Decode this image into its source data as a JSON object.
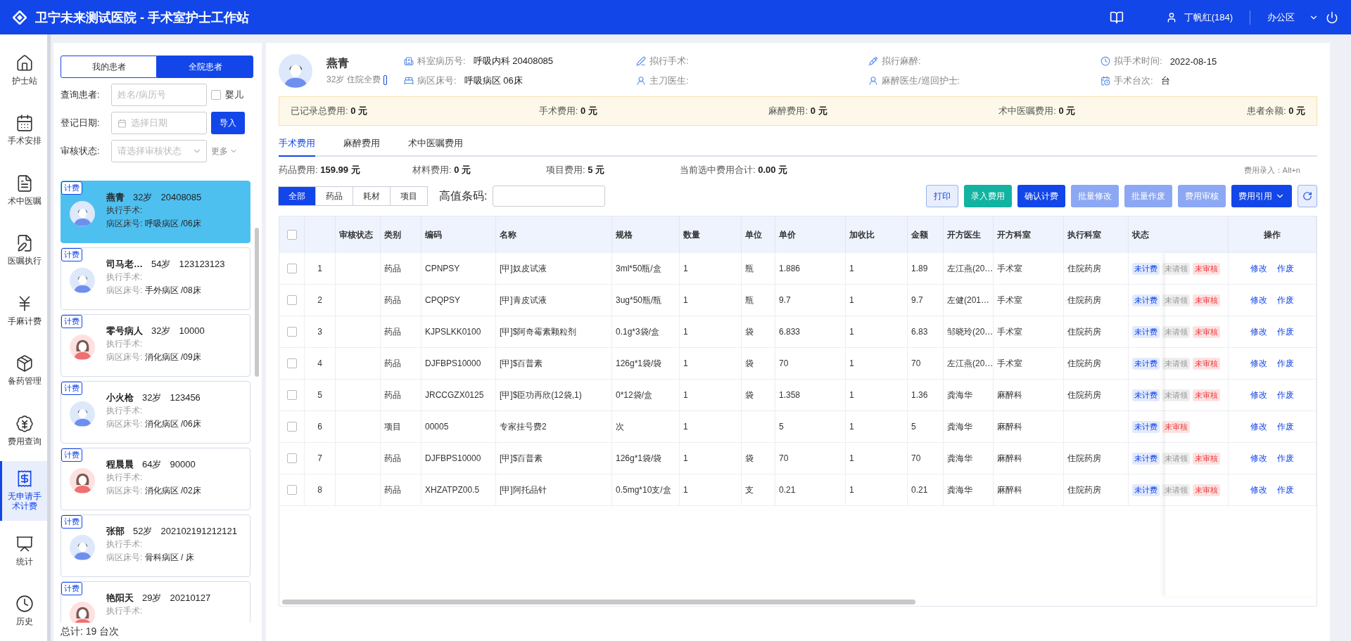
{
  "header": {
    "title": "卫宁未来测试医院 - 手术室护士工作站",
    "user": "丁帆红(184)",
    "location": "办公区"
  },
  "nav": [
    {
      "label": "护士站",
      "selected": false
    },
    {
      "label": "手术安排",
      "selected": false
    },
    {
      "label": "术中医嘱",
      "selected": false
    },
    {
      "label": "医嘱执行",
      "selected": false
    },
    {
      "label": "手麻计费",
      "selected": false
    },
    {
      "label": "备药管理",
      "selected": false
    },
    {
      "label": "费用查询",
      "selected": false
    },
    {
      "label": "无申请手术计费",
      "selected": true
    },
    {
      "label": "统计",
      "selected": false
    },
    {
      "label": "历史",
      "selected": false
    }
  ],
  "patient_panel": {
    "scope_tabs": [
      {
        "label": "我的患者",
        "selected": false
      },
      {
        "label": "全院患者",
        "selected": true
      }
    ],
    "query": {
      "label": "查询患者:",
      "placeholder": "姓名/病历号",
      "infant": {
        "label": "婴儿",
        "checked": false
      }
    },
    "date": {
      "label": "登记日期:",
      "placeholder": "选择日期",
      "button": "导入"
    },
    "audit": {
      "label": "审核状态:",
      "placeholder": "请选择审核状态",
      "more": "更多"
    },
    "patients": [
      {
        "tag": "计费",
        "name": "燕青",
        "age": "32岁",
        "id": "20408085",
        "surgery_label": "执行手术:",
        "ward_label": "病区床号:",
        "ward": "呼吸病区 /06床",
        "kind": "male",
        "selected": true
      },
      {
        "tag": "计费",
        "name": "司马老…",
        "age": "54岁",
        "id": "123123123",
        "surgery_label": "执行手术:",
        "ward_label": "病区床号:",
        "ward": "手外病区 /08床",
        "kind": "male",
        "selected": false
      },
      {
        "tag": "计费",
        "name": "零号病人",
        "age": "32岁",
        "id": "10000",
        "surgery_label": "执行手术:",
        "ward_label": "病区床号:",
        "ward": "消化病区 /09床",
        "kind": "female",
        "selected": false
      },
      {
        "tag": "计费",
        "name": "小火枪",
        "age": "32岁",
        "id": "123456",
        "surgery_label": "执行手术:",
        "ward_label": "病区床号:",
        "ward": "消化病区 /06床",
        "kind": "male",
        "selected": false
      },
      {
        "tag": "计费",
        "name": "程晨晨",
        "age": "64岁",
        "id": "90000",
        "surgery_label": "执行手术:",
        "ward_label": "病区床号:",
        "ward": "消化病区 /02床",
        "kind": "female",
        "selected": false
      },
      {
        "tag": "计费",
        "name": "张部",
        "age": "52岁",
        "id": "202102191212121",
        "surgery_label": "执行手术:",
        "ward_label": "病区床号:",
        "ward": "骨科病区 / 床",
        "kind": "male",
        "selected": false
      },
      {
        "tag": "计费",
        "name": "艳阳天",
        "age": "29岁",
        "id": "20210127",
        "surgery_label": "执行手术:",
        "kind": "female",
        "selected": false
      }
    ],
    "total": "总计:  19 台次"
  },
  "patient": {
    "name": "燕青",
    "meta": "32岁 住院全费",
    "fields": [
      {
        "label": "科室病历号:",
        "value": "呼吸内科 20408085"
      },
      {
        "label": "拟行手术:"
      },
      {
        "label": "拟行麻醉:"
      },
      {
        "label": "拟手术时间:",
        "value": "2022-08-15"
      },
      {
        "label": "病区床号:",
        "value": "呼吸病区 06床"
      },
      {
        "label": "主刀医生:"
      },
      {
        "label": "麻醉医生/巡回护士:"
      },
      {
        "label": "手术台次:",
        "value": "台"
      }
    ]
  },
  "summary": [
    {
      "label": "已记录总费用:",
      "value": "0 元"
    },
    {
      "label": "手术费用:",
      "value": "0 元"
    },
    {
      "label": "麻醉费用:",
      "value": "0 元"
    },
    {
      "label": "术中医嘱费用:",
      "value": "0 元"
    },
    {
      "label": "患者余额:",
      "value": "0 元"
    }
  ],
  "tabs": [
    {
      "label": "手术费用",
      "selected": true
    },
    {
      "label": "麻醉费用",
      "selected": false
    },
    {
      "label": "术中医嘱费用",
      "selected": false
    }
  ],
  "fees": [
    {
      "label": "药品费用:",
      "value": "159.99 元"
    },
    {
      "label": "材料费用:",
      "value": "0 元"
    },
    {
      "label": "项目费用:",
      "value": "5 元"
    },
    {
      "label": "当前选中费用合计:",
      "value": "0.00 元"
    }
  ],
  "shortcut_hint": "费用录入：Alt+n",
  "filters": [
    {
      "label": "全部",
      "selected": true
    },
    {
      "label": "药品",
      "selected": false
    },
    {
      "label": "耗材",
      "selected": false
    },
    {
      "label": "项目",
      "selected": false
    }
  ],
  "barcode": {
    "label": "高值条码:"
  },
  "actions": [
    {
      "label": "打印",
      "kind": "outline"
    },
    {
      "label": "录入费用",
      "kind": "success"
    },
    {
      "label": "确认计费",
      "kind": "primary"
    },
    {
      "label": "批量修改",
      "kind": "disabled"
    },
    {
      "label": "批量作废",
      "kind": "disabled"
    },
    {
      "label": "费用审核",
      "kind": "disabled"
    },
    {
      "label": "费用引用",
      "kind": "dropdown"
    },
    {
      "kind": "refresh"
    }
  ],
  "table": {
    "select_all": {
      "checked": false
    },
    "columns": [
      "审核状态",
      "类别",
      "编码",
      "名称",
      "规格",
      "数量",
      "单位",
      "单价",
      "加收比",
      "金额",
      "开方医生",
      "开方科室",
      "执行科室",
      "状态",
      "操作"
    ],
    "rows": [
      {
        "checked": false,
        "index": "1",
        "category": "药品",
        "code": "CPNPSY",
        "name": "[甲]奴皮试液",
        "spec": "3ml*50瓶/盒",
        "qty": "1",
        "unit": "瓶",
        "price": "1.886",
        "ratio": "1",
        "amount": "1.89",
        "doctor": "左江燕(20…",
        "dept": "手术室",
        "exec_dept": "住院药房",
        "tags": [
          {
            "label": "未计费",
            "kind": "info"
          },
          {
            "label": "未请领",
            "kind": "muted"
          },
          {
            "label": "未审核",
            "kind": "danger"
          }
        ],
        "ops": [
          "修改",
          "作废"
        ]
      },
      {
        "checked": false,
        "index": "2",
        "category": "药品",
        "code": "CPQPSY",
        "name": "[甲]青皮试液",
        "spec": "3ug*50瓶/瓶",
        "qty": "1",
        "unit": "瓶",
        "price": "9.7",
        "ratio": "1",
        "amount": "9.7",
        "doctor": "左健(201…",
        "dept": "手术室",
        "exec_dept": "住院药房",
        "tags": [
          {
            "label": "未计费",
            "kind": "info"
          },
          {
            "label": "未请领",
            "kind": "muted"
          },
          {
            "label": "未审核",
            "kind": "danger"
          }
        ],
        "ops": [
          "修改",
          "作废"
        ]
      },
      {
        "checked": false,
        "index": "3",
        "category": "药品",
        "code": "KJPSLKK0100",
        "name": "[甲]$阿奇霉素颗粒剂",
        "spec": "0.1g*3袋/盒",
        "qty": "1",
        "unit": "袋",
        "price": "6.833",
        "ratio": "1",
        "amount": "6.83",
        "doctor": "邹晓玲(20…",
        "dept": "手术室",
        "exec_dept": "住院药房",
        "tags": [
          {
            "label": "未计费",
            "kind": "info"
          },
          {
            "label": "未请领",
            "kind": "muted"
          },
          {
            "label": "未审核",
            "kind": "danger"
          }
        ],
        "ops": [
          "修改",
          "作废"
        ]
      },
      {
        "checked": false,
        "index": "4",
        "category": "药品",
        "code": "DJFBPS10000",
        "name": "[甲]$百普素",
        "spec": "126g*1袋/袋",
        "qty": "1",
        "unit": "袋",
        "price": "70",
        "ratio": "1",
        "amount": "70",
        "doctor": "左江燕(20…",
        "dept": "手术室",
        "exec_dept": "住院药房",
        "tags": [
          {
            "label": "未计费",
            "kind": "info"
          },
          {
            "label": "未请领",
            "kind": "muted"
          },
          {
            "label": "未审核",
            "kind": "danger"
          }
        ],
        "ops": [
          "修改",
          "作废"
        ]
      },
      {
        "checked": false,
        "index": "5",
        "category": "药品",
        "code": "JRCCGZX0125",
        "name": "[甲]$臣功再欣(12袋,1)",
        "spec": "0*12袋/盒",
        "qty": "1",
        "unit": "袋",
        "price": "1.358",
        "ratio": "1",
        "amount": "1.36",
        "doctor": "龚海华",
        "dept": "麻醉科",
        "exec_dept": "住院药房",
        "tags": [
          {
            "label": "未计费",
            "kind": "info"
          },
          {
            "label": "未请领",
            "kind": "muted"
          },
          {
            "label": "未审核",
            "kind": "danger"
          }
        ],
        "ops": [
          "修改",
          "作废"
        ]
      },
      {
        "checked": false,
        "index": "6",
        "category": "项目",
        "code": "00005",
        "name": "专家挂号费2",
        "spec": "次",
        "qty": "1",
        "price": "5",
        "ratio": "1",
        "amount": "5",
        "doctor": "龚海华",
        "dept": "麻醉科",
        "tags": [
          {
            "label": "未计费",
            "kind": "info"
          },
          {
            "label": "未审核",
            "kind": "danger"
          }
        ],
        "ops": [
          "修改",
          "作废"
        ]
      },
      {
        "checked": false,
        "index": "7",
        "category": "药品",
        "code": "DJFBPS10000",
        "name": "[甲]$百普素",
        "spec": "126g*1袋/袋",
        "qty": "1",
        "unit": "袋",
        "price": "70",
        "ratio": "1",
        "amount": "70",
        "doctor": "龚海华",
        "dept": "麻醉科",
        "exec_dept": "住院药房",
        "tags": [
          {
            "label": "未计费",
            "kind": "info"
          },
          {
            "label": "未请领",
            "kind": "muted"
          },
          {
            "label": "未审核",
            "kind": "danger"
          }
        ],
        "ops": [
          "修改",
          "作废"
        ]
      },
      {
        "checked": false,
        "index": "8",
        "category": "药品",
        "code": "XHZATPZ00.5",
        "name": "[甲]阿托品针",
        "spec": "0.5mg*10支/盒",
        "qty": "1",
        "unit": "支",
        "price": "0.21",
        "ratio": "1",
        "amount": "0.21",
        "doctor": "龚海华",
        "dept": "麻醉科",
        "exec_dept": "住院药房",
        "tags": [
          {
            "label": "未计费",
            "kind": "info"
          },
          {
            "label": "未请领",
            "kind": "muted"
          },
          {
            "label": "未审核",
            "kind": "danger"
          }
        ],
        "ops": [
          "修改",
          "作废"
        ]
      }
    ]
  }
}
